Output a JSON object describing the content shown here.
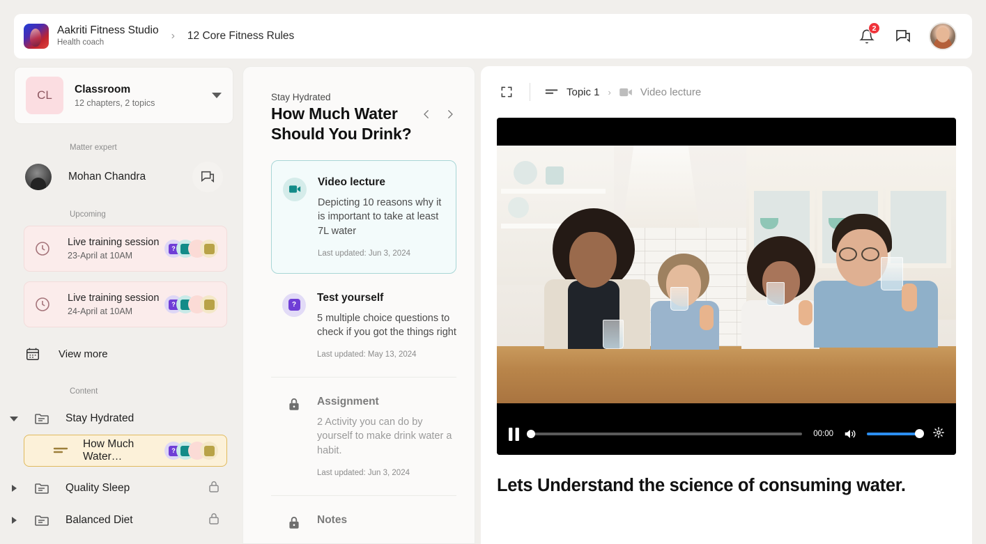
{
  "header": {
    "brand_title": "Aakriti Fitness Studio",
    "brand_subtitle": "Health coach",
    "breadcrumb_separator": "›",
    "current_page": "12 Core Fitness Rules",
    "notification_count": "2",
    "notification_icon": "bell-icon",
    "messages_icon": "chat-icon",
    "avatar_icon": "user-avatar"
  },
  "sidebar": {
    "classroom": {
      "initials": "CL",
      "name": "Classroom",
      "meta": "12 chapters, 2 topics",
      "dropdown_icon": "chevron-down-icon"
    },
    "matter_expert_label": "Matter expert",
    "expert": {
      "name": "Mohan Chandra",
      "chat_icon": "chat-icon"
    },
    "upcoming_label": "Upcoming",
    "events": [
      {
        "title": "Live training session",
        "time": "23-April at 10AM",
        "icon": "clock-icon"
      },
      {
        "title": "Live training session",
        "time": "24-April at 10AM",
        "icon": "clock-icon"
      }
    ],
    "view_more": {
      "label": "View more",
      "icon": "calendar-icon"
    },
    "content_label": "Content",
    "tree": [
      {
        "label": "Stay Hydrated",
        "icon": "folder-icon",
        "expanded": true,
        "locked": false,
        "active": false
      },
      {
        "label": "How Much Water…",
        "icon": "lesson-lines-icon",
        "expanded": false,
        "locked": false,
        "active": true
      },
      {
        "label": "Quality Sleep",
        "icon": "folder-icon",
        "expanded": false,
        "locked": true,
        "active": false
      },
      {
        "label": "Balanced Diet",
        "icon": "folder-icon",
        "expanded": false,
        "locked": true,
        "active": false
      }
    ],
    "badge_icons": [
      "quiz-badge",
      "video-badge",
      "pink-badge",
      "document-badge"
    ]
  },
  "middle": {
    "eyebrow": "Stay Hydrated",
    "title": "How Much Water Should You Drink?",
    "prev_icon": "chevron-left-icon",
    "next_icon": "chevron-right-icon",
    "lessons": [
      {
        "title": "Video lecture",
        "description": "Depicting 10 reasons why it is important to take at least 7L water",
        "updated": "Last updated: Jun 3, 2024",
        "icon": "video-icon",
        "selected": true,
        "locked": false
      },
      {
        "title": "Test yourself",
        "description": "5 multiple choice questions to check if you got the things right",
        "updated": "Last updated: May 13, 2024",
        "icon": "quiz-icon",
        "selected": false,
        "locked": false
      },
      {
        "title": "Assignment",
        "description": "2 Activity you can do by yourself to make drink water a habit.",
        "updated": "Last updated: Jun 3, 2024",
        "icon": "lock-icon",
        "selected": false,
        "locked": true
      },
      {
        "title": "Notes",
        "description": "",
        "updated": "",
        "icon": "lock-icon",
        "selected": false,
        "locked": true
      }
    ]
  },
  "right": {
    "expand_icon": "fullscreen-icon",
    "breadcrumb": {
      "topic_label": "Topic 1",
      "topic_icon": "lesson-lines-icon",
      "separator": "›",
      "item_label": "Video lecture",
      "item_icon": "video-icon"
    },
    "player": {
      "play_state_icon": "pause-icon",
      "current_time": "00:00",
      "volume_icon": "volume-on-icon",
      "settings_icon": "gear-icon",
      "progress_percent": 0,
      "volume_percent": 100,
      "accent_color": "#2c8ef0"
    },
    "video_title": "Lets Understand the science of consuming water."
  },
  "colors": {
    "page_bg": "#f1efec",
    "panel_bg": "#fbfaf9",
    "white": "#ffffff",
    "accent_teal": "#138b88",
    "accent_purple": "#6f3ed6",
    "accent_amber": "#e0ba5d",
    "badge_red": "#f0333a"
  }
}
